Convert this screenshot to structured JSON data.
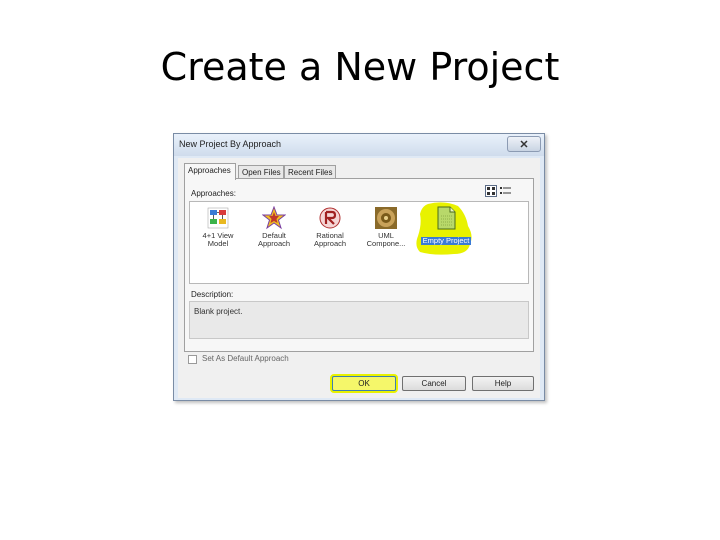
{
  "slide": {
    "title": "Create a New Project"
  },
  "dialog": {
    "title": "New Project By Approach",
    "close_icon": "close-icon",
    "tabs": [
      {
        "label": "Approaches",
        "active": true
      },
      {
        "label": "Open Files",
        "active": false
      },
      {
        "label": "Recent Files",
        "active": false
      }
    ],
    "approaches_label": "Approaches:",
    "approaches": [
      {
        "label_line1": "4+1 View",
        "label_line2": "Model",
        "icon": "model-icon"
      },
      {
        "label_line1": "Default",
        "label_line2": "Approach",
        "icon": "star-icon"
      },
      {
        "label_line1": "Rational",
        "label_line2": "Approach",
        "icon": "rational-icon"
      },
      {
        "label_line1": "UML",
        "label_line2": "Compone...",
        "icon": "component-icon"
      },
      {
        "label_line1": "Empty Project",
        "label_line2": "",
        "icon": "empty-project-icon",
        "selected": true
      }
    ],
    "description_label": "Description:",
    "description": "Blank project.",
    "set_default_label": "Set As Default Approach",
    "buttons": {
      "ok": "OK",
      "cancel": "Cancel",
      "help": "Help"
    },
    "highlight_color": "#e8f200"
  }
}
